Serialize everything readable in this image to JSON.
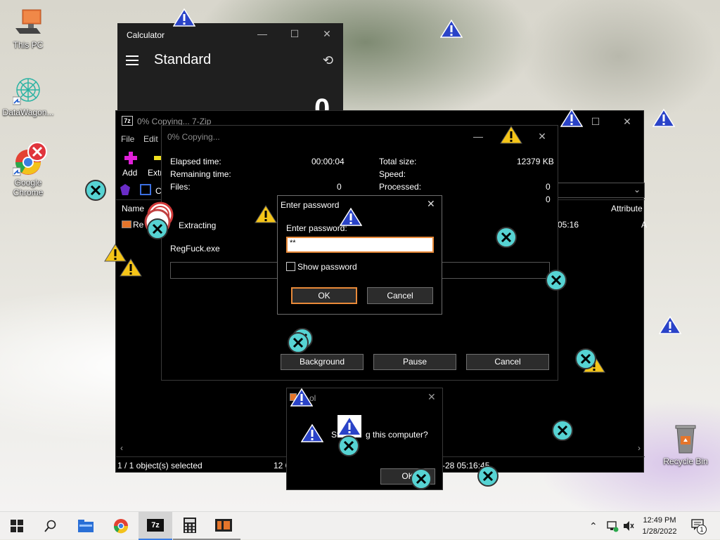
{
  "desktop_icons": [
    {
      "label": "This PC"
    },
    {
      "label": "DataWagon..."
    },
    {
      "label": "Google Chrome"
    },
    {
      "label": "Recycle Bin"
    }
  ],
  "calculator": {
    "title": "Calculator",
    "mode": "Standard",
    "display": "0"
  },
  "sevenzip": {
    "title": "0% Copying... 7-Zip",
    "menu": [
      "File",
      "Edit"
    ],
    "toolbar": [
      "Add",
      "Extr"
    ],
    "path_partial": "C",
    "col_name": "Name",
    "col_attributes": "Attribute",
    "row_name": "Re",
    "row_time": "05:16",
    "row_attr": "A",
    "status_left": "1 / 1 object(s) selected",
    "status_mid": "12 6",
    "status_right": "-28 05:16:45"
  },
  "copying": {
    "title": "0% Copying...",
    "elapsed_label": "Elapsed time:",
    "elapsed_value": "00:00:04",
    "remaining_label": "Remaining time:",
    "files_label": "Files:",
    "files_value": "0",
    "total_label": "Total size:",
    "total_value": "12379 KB",
    "speed_label": "Speed:",
    "processed_label": "Processed:",
    "processed_value": "0",
    "extra_value": "0",
    "extracting": "Extracting",
    "filename": "RegFuck.exe",
    "progress": 0,
    "background_btn": "Background",
    "pause_btn": "Pause",
    "cancel_btn": "Cancel"
  },
  "password_dialog": {
    "title": "Enter password",
    "prompt": "Enter password:",
    "value": "**",
    "show_password": "Show password",
    "ok": "OK",
    "cancel": "Cancel"
  },
  "message_box": {
    "title": "ol",
    "message_start": "St",
    "message_end": "g this computer?",
    "ok": "OK"
  },
  "taskbar": {
    "time": "12:49 PM",
    "date": "1/28/2022",
    "notif_count": "1"
  },
  "colors": {
    "warn_yellow": "#f5c518",
    "warn_blue": "#2a43c8",
    "error_red": "#e0343c",
    "x_cyan": "#56d3d3",
    "accent_orange": "#e98a39"
  }
}
